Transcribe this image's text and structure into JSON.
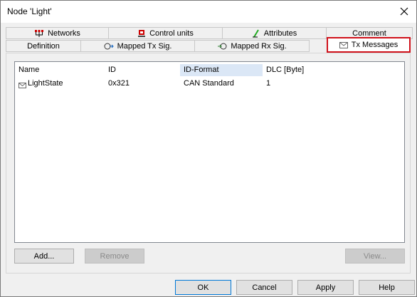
{
  "window": {
    "title": "Node 'Light'"
  },
  "tabs": {
    "row1": [
      {
        "label": "Networks",
        "icon": "networks-icon"
      },
      {
        "label": "Control units",
        "icon": "control-units-icon"
      },
      {
        "label": "Attributes",
        "icon": "attributes-icon"
      },
      {
        "label": "Comment"
      }
    ],
    "row2": [
      {
        "label": "Definition"
      },
      {
        "label": "Mapped Tx Sig.",
        "icon": "mapped-tx-icon"
      },
      {
        "label": "Mapped Rx Sig.",
        "icon": "mapped-rx-icon"
      },
      {
        "label": "Tx Messages",
        "icon": "envelope-icon",
        "active": true
      }
    ]
  },
  "table": {
    "columns": [
      "Name",
      "ID",
      "ID-Format",
      "DLC [Byte]"
    ],
    "selected_column": "ID-Format",
    "rows": [
      {
        "name": "LightState",
        "id": "0x321",
        "id_format": "CAN Standard",
        "dlc": "1",
        "icon": "envelope-icon"
      }
    ]
  },
  "buttons": {
    "add": "Add...",
    "remove": "Remove",
    "view": "View...",
    "ok": "OK",
    "cancel": "Cancel",
    "apply": "Apply",
    "help": "Help"
  },
  "colors": {
    "highlight_border": "#d0121b",
    "selected_header": "#dbe7f6",
    "default_button_border": "#0078d7"
  }
}
